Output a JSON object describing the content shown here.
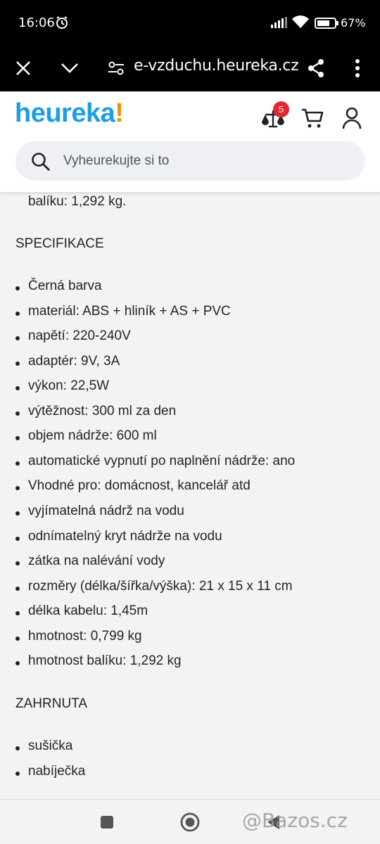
{
  "status": {
    "time": "16:06",
    "battery": "67%"
  },
  "browser": {
    "url": "e-vzduchu.heureka.cz"
  },
  "header": {
    "logo_main": "heureka",
    "logo_bang": "!",
    "badge_count": "5",
    "search_placeholder": "Vyheurekujte si to"
  },
  "content": {
    "top_text": "balíku: 1,292 kg.",
    "specs_heading": "SPECIFIKACE",
    "specs": [
      "Černá barva",
      "materiál: ABS + hliník + AS + PVC",
      "napětí: 220-240V",
      "adaptér: 9V, 3A",
      "výkon: 22,5W",
      "výtěžnost: 300 ml za den",
      "objem nádrže: 600 ml",
      "automatické vypnutí po naplnění nádrže: ano",
      "Vhodné pro: domácnost, kancelář atd",
      "vyjímatelná nádrž na vodu",
      "odnímatelný kryt nádrže na vodu",
      "zátka na nalévání vody",
      "rozměry (délka/šířka/výška): 21 x 15 x 11 cm",
      "délka kabelu: 1,45m",
      "hmotnost: 0,799 kg",
      "hmotnost balíku: 1,292 kg"
    ],
    "included_heading": "ZAHRNUTA",
    "included": [
      "sušička",
      "nabíječka"
    ]
  },
  "watermark": "@Bazos.cz"
}
